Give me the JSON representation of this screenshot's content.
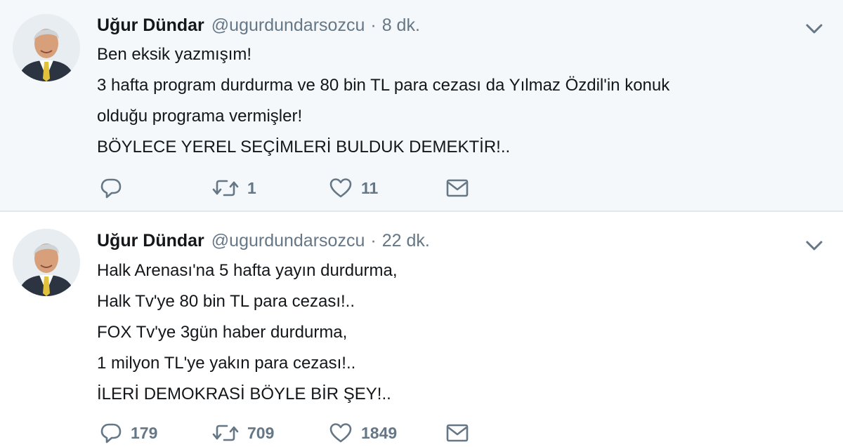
{
  "tweets": [
    {
      "author": {
        "name": "Uğur Dündar",
        "handle": "@ugurdundarsozcu",
        "avatar_icon": "profile-photo"
      },
      "separator": "·",
      "time": "8 dk.",
      "lines": [
        "Ben eksik yazmışım!",
        "3 hafta program durdurma ve 80 bin TL para cezası da Yılmaz Özdil'in konuk",
        "olduğu programa vermişler!",
        "BÖYLECE YEREL SEÇİMLERİ BULDUK DEMEKTİR!.."
      ],
      "actions": {
        "reply": {
          "icon": "reply-icon",
          "count": ""
        },
        "retweet": {
          "icon": "retweet-icon",
          "count": "1"
        },
        "like": {
          "icon": "heart-icon",
          "count": "11"
        },
        "dm": {
          "icon": "envelope-icon"
        }
      }
    },
    {
      "author": {
        "name": "Uğur Dündar",
        "handle": "@ugurdundarsozcu",
        "avatar_icon": "profile-photo"
      },
      "separator": "·",
      "time": "22 dk.",
      "lines": [
        "Halk Arenası'na 5 hafta yayın durdurma,",
        "Halk Tv'ye 80 bin TL para cezası!..",
        "FOX Tv'ye 3gün haber durdurma,",
        "1 milyon TL'ye yakın para cezası!..",
        "İLERİ DEMOKRASİ BÖYLE BİR ŞEY!.."
      ],
      "actions": {
        "reply": {
          "icon": "reply-icon",
          "count": "179"
        },
        "retweet": {
          "icon": "retweet-icon",
          "count": "709"
        },
        "like": {
          "icon": "heart-icon",
          "count": "1849"
        },
        "dm": {
          "icon": "envelope-icon"
        }
      }
    }
  ],
  "colors": {
    "text_primary": "#14171a",
    "text_secondary": "#657786",
    "highlight_background": "#f5f8fa",
    "divider": "#e1e8ed"
  }
}
